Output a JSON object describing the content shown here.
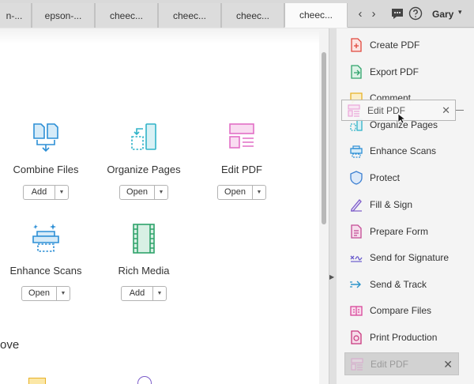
{
  "tabs": [
    {
      "label": "n-..."
    },
    {
      "label": "epson-..."
    },
    {
      "label": "cheec..."
    },
    {
      "label": "cheec..."
    },
    {
      "label": "cheec..."
    },
    {
      "label": "cheec...",
      "active": true
    }
  ],
  "nav": {
    "prev": "‹",
    "next": "›"
  },
  "header": {
    "user": "Gary",
    "caret": "▾"
  },
  "tools": [
    {
      "label": "Combine Files",
      "action": "Add",
      "icon": "combine-files-icon"
    },
    {
      "label": "Organize Pages",
      "action": "Open",
      "icon": "organize-pages-icon"
    },
    {
      "label": "Edit PDF",
      "action": "Open",
      "icon": "edit-pdf-icon"
    },
    {
      "label": "Enhance Scans",
      "action": "Open",
      "icon": "enhance-scans-icon"
    },
    {
      "label": "Rich Media",
      "action": "Add",
      "icon": "rich-media-icon"
    }
  ],
  "main": {
    "section_heading": "ove"
  },
  "right_pane": {
    "items": [
      {
        "label": "Create PDF",
        "icon": "create-pdf-icon",
        "color": "#e0483d"
      },
      {
        "label": "Export PDF",
        "icon": "export-pdf-icon",
        "color": "#2fa36b"
      },
      {
        "label": "Comment",
        "icon": "comment-icon",
        "color": "#e8b228"
      },
      {
        "label": "Organize Pages",
        "icon": "organize-pages-icon",
        "color": "#30b3c8"
      },
      {
        "label": "Enhance Scans",
        "icon": "enhance-scans-icon",
        "color": "#2d8fd6"
      },
      {
        "label": "Protect",
        "icon": "protect-icon",
        "color": "#3b7fd1"
      },
      {
        "label": "Fill & Sign",
        "icon": "fill-sign-icon",
        "color": "#7c5cc9"
      },
      {
        "label": "Prepare Form",
        "icon": "prepare-form-icon",
        "color": "#c44a94"
      },
      {
        "label": "Send for Signature",
        "icon": "send-for-signature-icon",
        "color": "#6a5ccc"
      },
      {
        "label": "Send & Track",
        "icon": "send-track-icon",
        "color": "#2c94c9"
      },
      {
        "label": "Compare Files",
        "icon": "compare-files-icon",
        "color": "#d8469a"
      },
      {
        "label": "Print Production",
        "icon": "print-production-icon",
        "color": "#c8367d"
      }
    ],
    "drag_ghost": {
      "label": "Edit PDF",
      "close": "✕"
    },
    "drop_placeholder": {
      "label": "Edit PDF",
      "close": "✕"
    }
  },
  "colors": {
    "edit_pdf": "#e26fc6",
    "organize": "#30b3c8",
    "combine": "#2d8fd6",
    "rich_media": "#2fa36b"
  }
}
